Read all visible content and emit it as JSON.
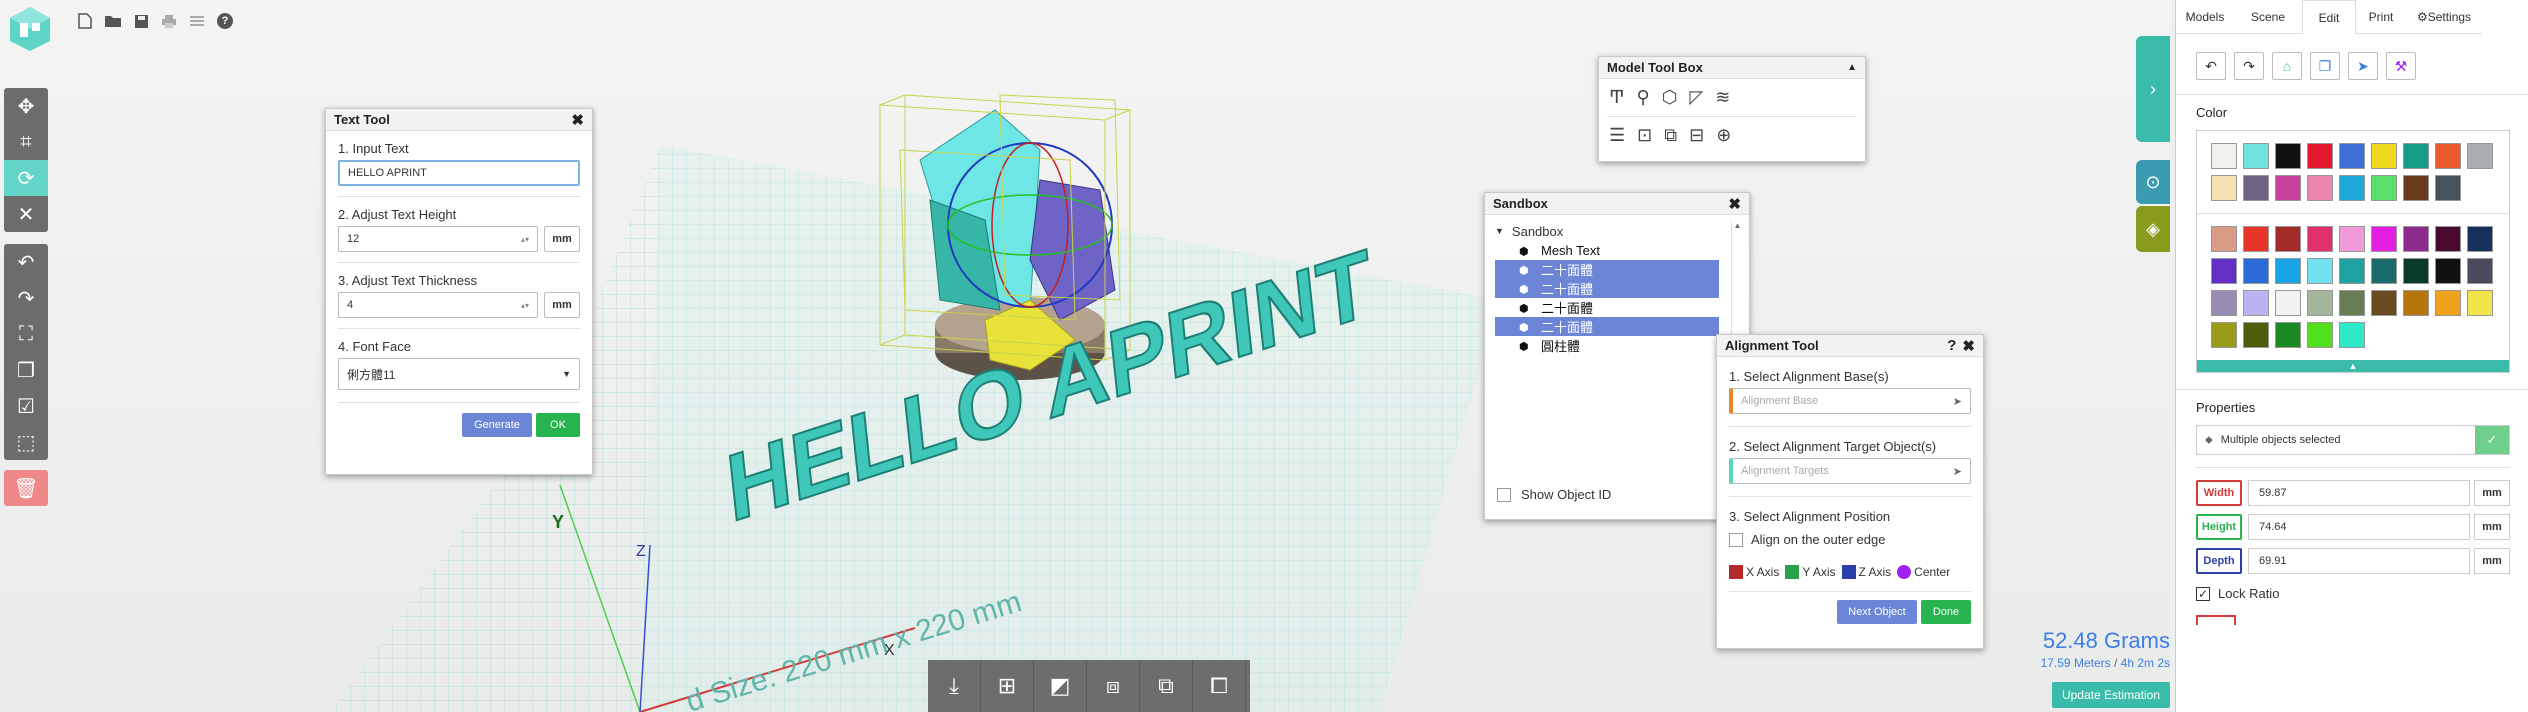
{
  "toolbar": {
    "icons": [
      "new-file-icon",
      "open-folder-icon",
      "save-icon",
      "print-icon",
      "settings-sliders-icon",
      "help-icon"
    ],
    "help_glyph": "?"
  },
  "text_tool": {
    "title": "Text Tool",
    "step1_label": "1. Input Text",
    "input_text": "HELLO APRINT",
    "step2_label": "2. Adjust Text Height",
    "height_value": "12",
    "height_unit": "mm",
    "step3_label": "3. Adjust Text Thickness",
    "thickness_value": "4",
    "thickness_unit": "mm",
    "step4_label": "4. Font Face",
    "font_face": "俐方體11",
    "generate_label": "Generate",
    "ok_label": "OK"
  },
  "model_toolbox": {
    "title": "Model Tool Box"
  },
  "sandbox": {
    "title": "Sandbox",
    "root_label": "Sandbox",
    "items": [
      {
        "label": "Mesh Text",
        "selected": false
      },
      {
        "label": "二十面體",
        "selected": true
      },
      {
        "label": "二十面體",
        "selected": true
      },
      {
        "label": "二十面體",
        "selected": false
      },
      {
        "label": "二十面體",
        "selected": true
      },
      {
        "label": "圓柱體",
        "selected": false
      }
    ],
    "show_object_id_label": "Show Object ID"
  },
  "alignment_tool": {
    "title": "Alignment Tool",
    "help_glyph": "?",
    "step1_label": "1. Select Alignment Base(s)",
    "base_placeholder": "Alignment Base",
    "step2_label": "2. Select Alignment Target Object(s)",
    "target_placeholder": "Alignment Targets",
    "step3_label": "3. Select Alignment Position",
    "outer_edge_label": "Align on the outer edge",
    "axes": [
      {
        "label": "X Axis",
        "color": "#b52b2b"
      },
      {
        "label": "Y Axis",
        "color": "#27a34a"
      },
      {
        "label": "Z Axis",
        "color": "#2b3fa8"
      },
      {
        "label": "Center",
        "color": "#a020f0"
      }
    ],
    "next_label": "Next Object",
    "done_label": "Done"
  },
  "scene": {
    "build_plate_label": "d Size: 220 mm x 220 mm",
    "model_text": "HELLO APRINT",
    "axis_y": "Y",
    "axis_x": "X",
    "axis_z": "Z"
  },
  "estimate": {
    "weight": "52.48 Grams",
    "length": "17.59 Meters",
    "separator": " / ",
    "time": "4h 2m 2s",
    "update_label": "Update Estimation"
  },
  "right_panel": {
    "tabs": [
      {
        "label": "Models",
        "active": false
      },
      {
        "label": "Scene",
        "active": false
      },
      {
        "label": "Edit",
        "active": true
      },
      {
        "label": "Print",
        "active": false
      },
      {
        "label": "Settings",
        "active": false
      }
    ],
    "color_heading": "Color",
    "swatches_top": [
      "#f1f2ea",
      "#6ee3dc",
      "#111111",
      "#e3182d",
      "#3e6fd6",
      "#f2d81c",
      "#169b87",
      "#ec5a2b",
      "#a7adb0",
      "#f3dfb2",
      "#6e6483",
      "#c9409f",
      "#ec84b0",
      "#1ea9d9",
      "#58e06b",
      "#6b3a1e",
      "#49525a"
    ],
    "swatches_bottom": [
      "#d99b86",
      "#e8352b",
      "#a52a2a",
      "#e0306e",
      "#f09bd6",
      "#e61ee2",
      "#8c2a90",
      "#4a0a30",
      "#15305e",
      "#6230c9",
      "#2c6ad9",
      "#17a5e8",
      "#6fe0ec",
      "#1fa3a1",
      "#1d6b6b",
      "#0b3b2a",
      "#111111",
      "#4b4b5e",
      "#9a8cb0",
      "#b6b4f2",
      "#f2f2f2",
      "#a6b49e",
      "#6b7a56",
      "#6a4a20",
      "#b5740c",
      "#f0a11c",
      "#f1e44a",
      "#9a9a1c",
      "#4a5f0c",
      "#1a8b22",
      "#52e01c",
      "#2ee8c6"
    ],
    "properties_heading": "Properties",
    "selection_text": "Multiple objects selected",
    "width_label": "Width",
    "width_value": "59.87",
    "height_label": "Height",
    "height_value": "74.64",
    "depth_label": "Depth",
    "depth_value": "69.91",
    "unit": "mm",
    "lock_ratio_label": "Lock Ratio"
  },
  "colors": {
    "accent_teal": "#63d5c6",
    "primary_blue": "#6b86d6",
    "success_green": "#27b34d",
    "estimate_blue": "#3d7ee6"
  }
}
